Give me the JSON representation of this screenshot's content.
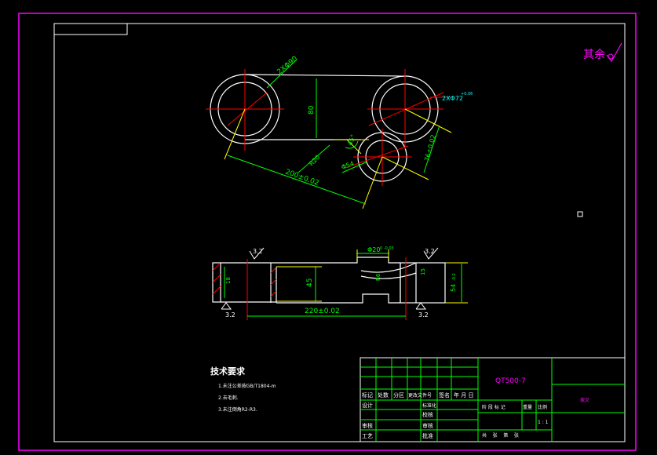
{
  "drawing": {
    "surface_mark_text": "其余",
    "top_view": {
      "dim_hole_large": "2XΦ90",
      "dim_hole_boss": "2XΦ72",
      "dim_hole_boss_tol": "+0.06",
      "dim_height": "80",
      "dim_angle": "45°",
      "dim_hole_small": "Φ54",
      "dim_radius": "R20",
      "dim_center_dist": "200±0.02",
      "dim_small_dist": "76±0.02"
    },
    "front_view": {
      "roughness_left_top": "3.2",
      "roughness_left_bottom": "3.2",
      "roughness_right_top": "3.2",
      "roughness_right_bottom": "3.2",
      "dim_left_small": "18",
      "dim_height": "45",
      "dim_slot": "Φ20",
      "dim_slot_tol": "0 -0.03",
      "dim_r6": "R6",
      "dim_15": "15",
      "dim_right": "54",
      "dim_right_tol": "-0.2",
      "dim_length": "220±0.02"
    },
    "tech_notes": {
      "title": "技术要求",
      "items": [
        "1.未注公差按GB/T1804-m",
        "2.去毛刺.",
        "3.未注倒角R2-R3."
      ]
    }
  },
  "title_block": {
    "material": "QT500-7",
    "part_name": "拨叉",
    "labels": {
      "mark": "标记",
      "count": "处数",
      "zone": "分区",
      "change_doc": "更改文件号",
      "sign": "签名",
      "date": "年 月 日",
      "design": "设计",
      "standardize": "标准化",
      "proofread": "校核",
      "review": "审核",
      "craft": "工艺",
      "approve": "批准",
      "stage": "阶 段 标 记",
      "weight": "重量",
      "scale": "比例",
      "scale_value": "1 : 1",
      "sheets": "共    张    第    张"
    }
  },
  "colors": {
    "border": "#ff00ff",
    "outline": "#ffffff",
    "dimension": "#00ff00",
    "center": "#ff0000",
    "leader": "#ffff00",
    "annotation": "#00ffff"
  }
}
